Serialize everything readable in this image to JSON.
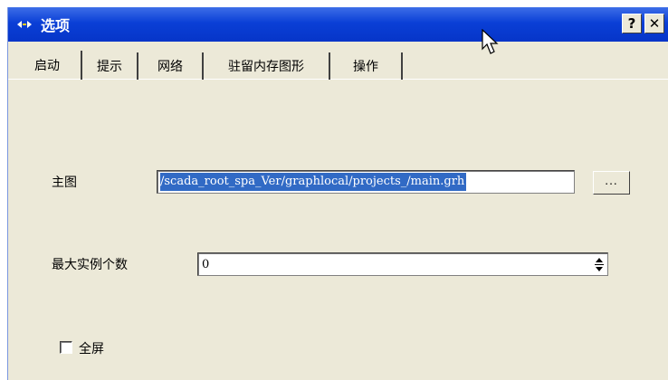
{
  "window": {
    "title": "选项",
    "help_label": "?",
    "close_label": "✕"
  },
  "tabs": [
    {
      "label": "启动",
      "active": true
    },
    {
      "label": "提示",
      "active": false
    },
    {
      "label": "网络",
      "active": false
    },
    {
      "label": "驻留内存图形",
      "active": false
    },
    {
      "label": "操作",
      "active": false
    }
  ],
  "startup": {
    "main_graph_label": "主图",
    "main_graph_value": "/scada_root_spa_Ver/graphlocal/projects_/main.grh",
    "browse_label": "...",
    "max_instances_label": "最大实例个数",
    "max_instances_value": "0",
    "fullscreen_label": "全屏",
    "fullscreen_checked": false
  },
  "colors": {
    "titlebar": "#0a3fd6",
    "face": "#ece9d8",
    "selection": "#316ac5"
  }
}
